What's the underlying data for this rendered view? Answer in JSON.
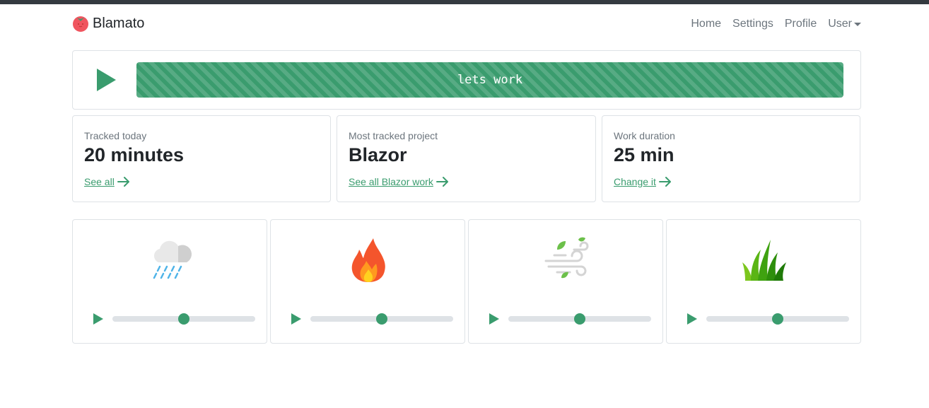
{
  "brand": {
    "name": "Blamato",
    "logo_icon": "tomato-icon"
  },
  "nav": {
    "items": [
      {
        "label": "Home"
      },
      {
        "label": "Settings"
      },
      {
        "label": "Profile"
      },
      {
        "label": "User"
      }
    ]
  },
  "timer": {
    "play_icon": "play-icon",
    "label": "lets work"
  },
  "stats": [
    {
      "label": "Tracked today",
      "value": "20 minutes",
      "link": "See all"
    },
    {
      "label": "Most tracked project",
      "value": "Blazor",
      "link": "See all Blazor work"
    },
    {
      "label": "Work duration",
      "value": "25 min",
      "link": "Change it"
    }
  ],
  "sounds": [
    {
      "icon": "rain-cloud-icon",
      "volume": 0.5
    },
    {
      "icon": "fire-icon",
      "volume": 0.5
    },
    {
      "icon": "wind-icon",
      "volume": 0.5
    },
    {
      "icon": "grass-icon",
      "volume": 0.5
    }
  ],
  "colors": {
    "accent": "#3a9c6e",
    "topbar": "#343a40",
    "muted_text": "#6c757d",
    "tomato": "#f0555f"
  }
}
